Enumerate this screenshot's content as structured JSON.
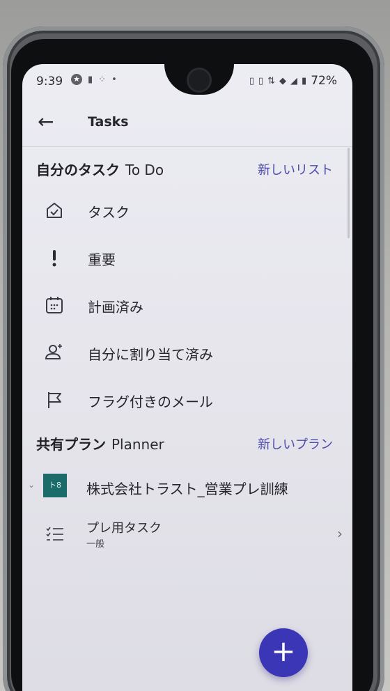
{
  "status_bar": {
    "time": "9:39",
    "battery": "72%"
  },
  "app_bar": {
    "title": "Tasks"
  },
  "my_tasks": {
    "title": "自分のタスク",
    "subtitle": "To Do",
    "new_link": "新しいリスト",
    "items": [
      {
        "label": "タスク",
        "icon": "house-check-icon"
      },
      {
        "label": "重要",
        "icon": "exclamation-icon"
      },
      {
        "label": "計画済み",
        "icon": "calendar-icon"
      },
      {
        "label": "自分に割り当て済み",
        "icon": "person-add-icon"
      },
      {
        "label": "フラグ付きのメール",
        "icon": "flag-icon"
      }
    ]
  },
  "shared_plans": {
    "title": "共有プラン",
    "subtitle": "Planner",
    "new_link": "新しいプラン",
    "plan": {
      "badge": "ト8",
      "name": "株式会社トラスト_営業プレ訓練",
      "badge_color": "#1b6b6b"
    },
    "task_list": {
      "title": "プレ用タスク",
      "subtitle": "一般"
    }
  },
  "fab": {
    "label": "+",
    "color": "#3b36b5"
  },
  "accent_color": "#4b4bab"
}
